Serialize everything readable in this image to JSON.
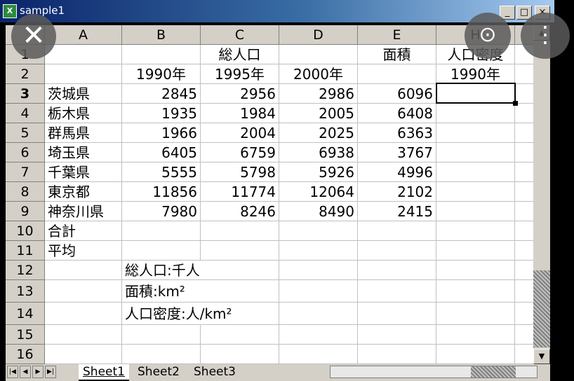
{
  "window": {
    "title": "sample1",
    "app_icon": "X",
    "minimize": "_",
    "maximize": "□",
    "close": "×"
  },
  "columns": [
    "A",
    "B",
    "C",
    "D",
    "E",
    "H"
  ],
  "rows": [
    "1",
    "2",
    "3",
    "4",
    "5",
    "6",
    "7",
    "8",
    "9",
    "10",
    "11",
    "12",
    "13",
    "14",
    "15",
    "16"
  ],
  "cells": {
    "r1": {
      "c": "総人口",
      "e": "面積",
      "h": "人口密度"
    },
    "r2": {
      "b": "1990年",
      "c": "1995年",
      "d": "2000年",
      "h": "1990年"
    },
    "data": [
      {
        "a": "茨城県",
        "b": "2845",
        "c": "2956",
        "d": "2986",
        "e": "6096"
      },
      {
        "a": "栃木県",
        "b": "1935",
        "c": "1984",
        "d": "2005",
        "e": "6408"
      },
      {
        "a": "群馬県",
        "b": "1966",
        "c": "2004",
        "d": "2025",
        "e": "6363"
      },
      {
        "a": "埼玉県",
        "b": "6405",
        "c": "6759",
        "d": "6938",
        "e": "3767"
      },
      {
        "a": "千葉県",
        "b": "5555",
        "c": "5798",
        "d": "5926",
        "e": "4996"
      },
      {
        "a": "東京都",
        "b": "11856",
        "c": "11774",
        "d": "12064",
        "e": "2102"
      },
      {
        "a": "神奈川県",
        "b": "7980",
        "c": "8246",
        "d": "8490",
        "e": "2415"
      }
    ],
    "r10": {
      "a": "合計"
    },
    "r11": {
      "a": "平均"
    },
    "r12": {
      "b": "総人口:千人"
    },
    "r13": {
      "b": "面積:km²"
    },
    "r14": {
      "b": "人口密度:人/km²"
    }
  },
  "tabs": [
    "Sheet1",
    "Sheet2",
    "Sheet3"
  ],
  "overlay": {
    "close_icon": "✕",
    "lens_icon": "⊙",
    "menu_icon": "⋮"
  }
}
